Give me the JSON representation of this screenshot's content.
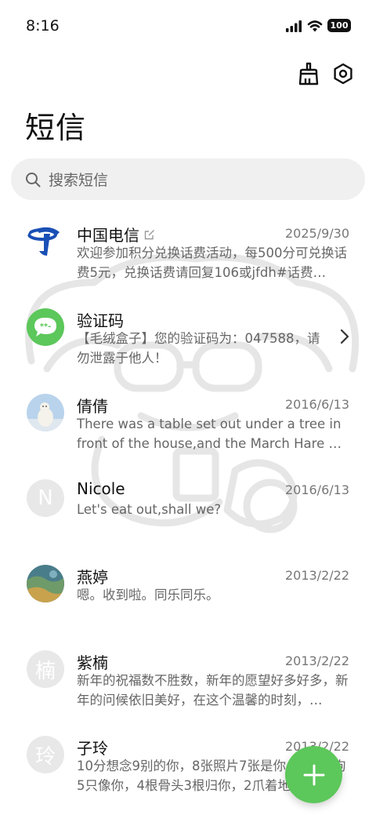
{
  "status": {
    "time": "8:16",
    "battery": "100"
  },
  "toolbar": {
    "clean_icon": "broom-icon",
    "settings_icon": "settings-icon"
  },
  "page": {
    "title": "短信"
  },
  "search": {
    "placeholder": "搜索短信"
  },
  "conversations": [
    {
      "name": "中国电信",
      "date": "2025/9/30",
      "preview": "欢迎参加积分兑换话费活动，每500分可兑换话费5元，兑换话费请回复106或jfdh#话费…",
      "avatar": "china-telecom-logo"
    },
    {
      "name": "验证码",
      "date": "",
      "preview": "【毛绒盒子】您的验证码为：047588，请勿泄露于他人！",
      "avatar": "message-icon"
    },
    {
      "name": "倩倩",
      "date": "2016/6/13",
      "preview": "There was a table set out under a tree in front of the house,and the March Hare an…",
      "avatar": "polar-bear-photo"
    },
    {
      "name": "Nicole",
      "date": "2016/6/13",
      "preview": "Let's eat out,shall we?",
      "avatar_letter": "N"
    },
    {
      "name": "燕婷",
      "date": "2013/2/22",
      "preview": "嗯。收到啦。同乐同乐。",
      "avatar": "landscape-photo"
    },
    {
      "name": "紫楠",
      "date": "2013/2/22",
      "preview": "新年的祝福数不胜数，新年的愿望好多好多，新年的问候依旧美好，在这个温馨的时刻，…",
      "avatar_letter": "楠"
    },
    {
      "name": "子玲",
      "date": "2013/2/22",
      "preview": "10分想念9别的你，8张照片7张是你，6只小狗5只像你，4根骨头3根归你，2爪着地1宝…",
      "avatar_letter": "玲"
    }
  ],
  "fab": {
    "icon": "plus-icon"
  },
  "colors": {
    "accent": "#5cc75a",
    "telecom_blue": "#1a4fb5"
  }
}
